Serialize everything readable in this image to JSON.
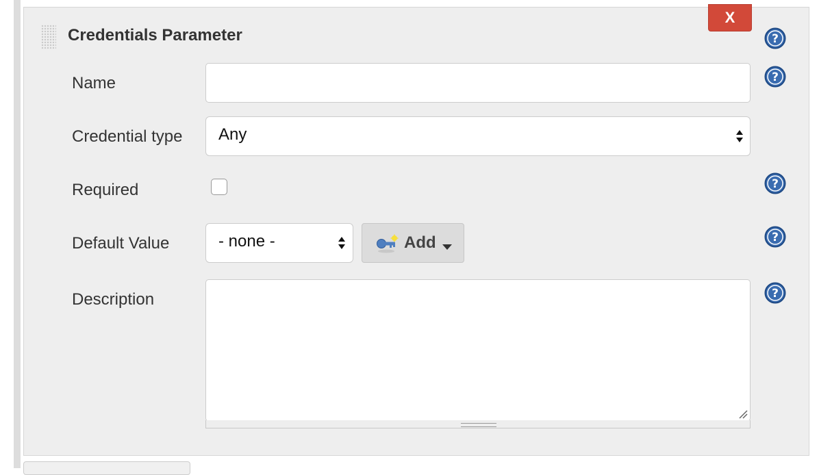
{
  "section": {
    "title": "Credentials Parameter",
    "delete_label": "X"
  },
  "form": {
    "name": {
      "label": "Name",
      "value": ""
    },
    "credential_type": {
      "label": "Credential type",
      "selected": "Any"
    },
    "required": {
      "label": "Required",
      "checked": false
    },
    "default_value": {
      "label": "Default Value",
      "selected": "- none -",
      "add_label": "Add"
    },
    "description": {
      "label": "Description",
      "value": ""
    }
  },
  "icons": {
    "help": "help-icon",
    "add": "key-add-icon",
    "caret": "caret-down-icon",
    "drag": "drag-handle-icon"
  },
  "colors": {
    "panel_bg": "#eeeeee",
    "delete_red": "#d24939",
    "help_blue": "#3a6cb0"
  }
}
